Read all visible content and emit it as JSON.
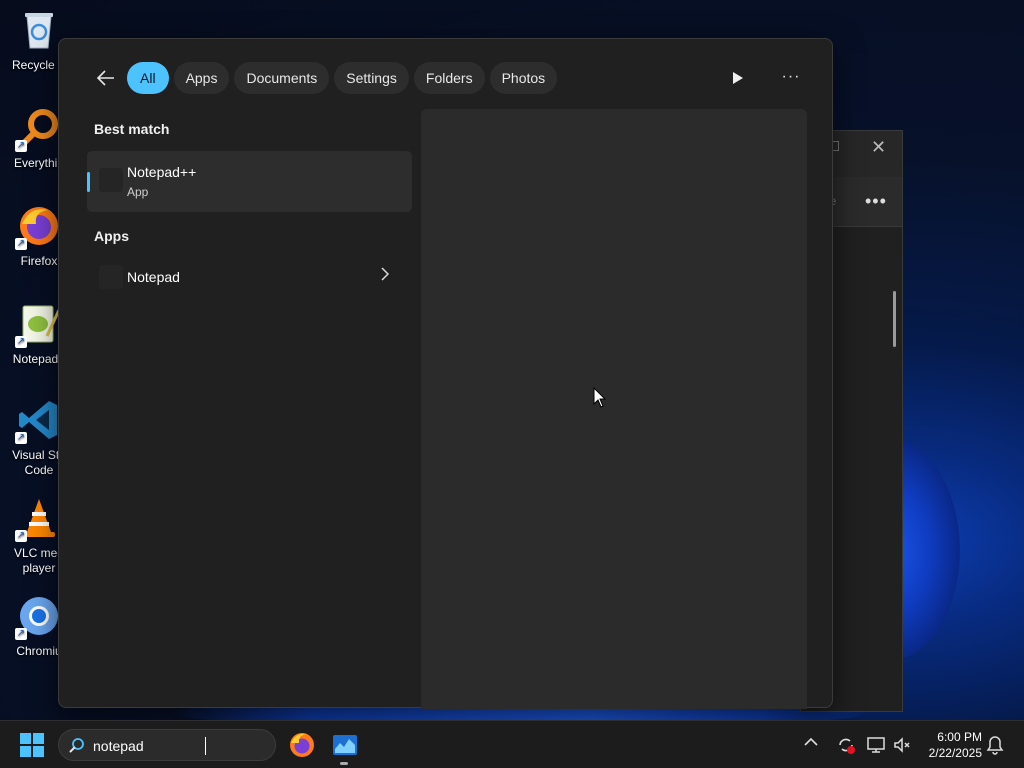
{
  "desktop": {
    "icons": [
      {
        "label": "Recycle B",
        "icon": "recycle-bin-icon"
      },
      {
        "label": "Everythin",
        "icon": "everything-search-icon"
      },
      {
        "label": "Firefox",
        "icon": "firefox-icon"
      },
      {
        "label": "Notepad+",
        "icon": "notepad-plus-plus-icon"
      },
      {
        "label": "Visual Stu\nCode",
        "icon": "vscode-icon"
      },
      {
        "label": "VLC med\nplayer",
        "icon": "vlc-icon"
      },
      {
        "label": "Chromiu",
        "icon": "chromium-icon"
      }
    ]
  },
  "background_window": {
    "toolbar_fragment": "de",
    "more_label": "•••"
  },
  "search_flyout": {
    "filters": [
      "All",
      "Apps",
      "Documents",
      "Settings",
      "Folders",
      "Photos"
    ],
    "active_filter": "All",
    "more_label": "···",
    "best_match": {
      "section_label": "Best match",
      "title": "Notepad++",
      "subtitle": "App"
    },
    "apps": {
      "section_label": "Apps",
      "items": [
        {
          "title": "Notepad"
        }
      ]
    }
  },
  "taskbar": {
    "search": {
      "value": "notepad",
      "placeholder": ""
    },
    "clock": {
      "time": "6:00 PM",
      "date": "2/22/2025"
    }
  },
  "colors": {
    "accent": "#4cc2ff",
    "flyout_bg": "#202020",
    "preview_bg": "#2b2b2b",
    "taskbar_bg": "#1c1c1c"
  }
}
